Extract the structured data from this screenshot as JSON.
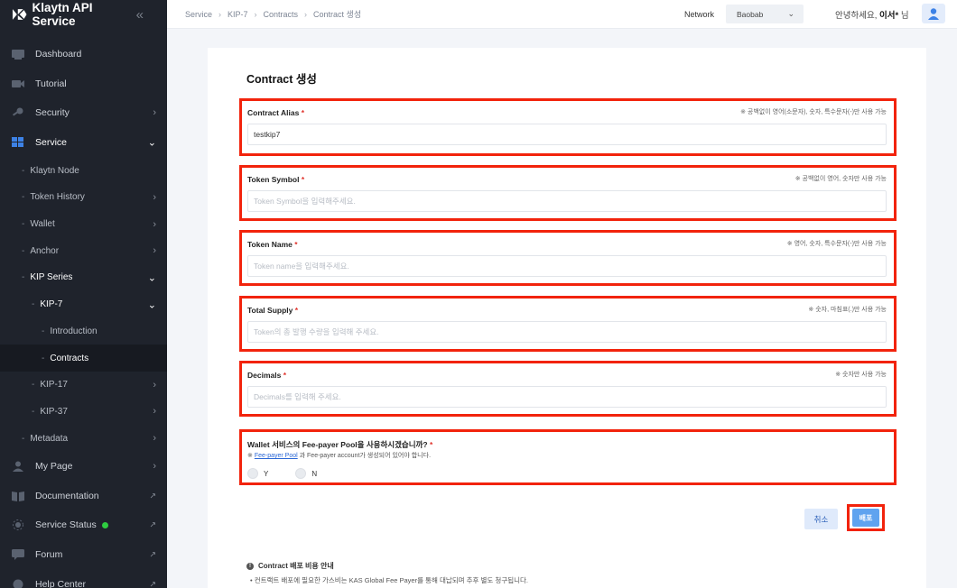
{
  "brand": {
    "name": "Klaytn API Service",
    "collapse_icon": "double-chevron-left"
  },
  "sidebar": {
    "items": [
      {
        "label": "Dashboard",
        "icon": "dashboard-icon"
      },
      {
        "label": "Tutorial",
        "icon": "video-icon"
      },
      {
        "label": "Security",
        "icon": "key-icon"
      },
      {
        "label": "Service",
        "icon": "grid-icon"
      },
      {
        "label": "Klaytn Node"
      },
      {
        "label": "Token History"
      },
      {
        "label": "Wallet"
      },
      {
        "label": "Anchor"
      },
      {
        "label": "KIP Series"
      },
      {
        "label": "KIP-7"
      },
      {
        "label": "Introduction"
      },
      {
        "label": "Contracts"
      },
      {
        "label": "KIP-17"
      },
      {
        "label": "KIP-37"
      },
      {
        "label": "Metadata"
      },
      {
        "label": "My Page",
        "icon": "user-icon"
      },
      {
        "label": "Documentation",
        "icon": "book-icon"
      },
      {
        "label": "Service Status",
        "icon": "status-icon",
        "status_color": "#2ecc40"
      },
      {
        "label": "Forum",
        "icon": "chat-icon"
      },
      {
        "label": "Help Center",
        "icon": "help-icon"
      }
    ]
  },
  "topbar": {
    "breadcrumb": [
      "Service",
      "KIP-7",
      "Contracts",
      "Contract 생성"
    ],
    "network_label": "Network",
    "network_value": "Baobab",
    "greeting_prefix": "안녕하세요,",
    "user_name": "이서*",
    "greeting_suffix": "님"
  },
  "form": {
    "title": "Contract 생성",
    "fields": [
      {
        "label": "Contract Alias",
        "hint": "※ 공백없이 영어(소문자), 숫자, 특수문자(-)만 사용 가능",
        "value": "testkip7",
        "placeholder": ""
      },
      {
        "label": "Token Symbol",
        "hint": "※ 공백없이 영어, 숫자만 사용 가능",
        "value": "",
        "placeholder": "Token Symbol을 입력해주세요."
      },
      {
        "label": "Token Name",
        "hint": "※ 영어, 숫자, 특수문자(-)만 사용 가능",
        "value": "",
        "placeholder": "Token name을 입력해주세요."
      },
      {
        "label": "Total Supply",
        "hint": "※ 숫자, 마침표(.)만 사용 가능",
        "value": "",
        "placeholder": "Token의 총 발행 수량을 입력해 주세요."
      },
      {
        "label": "Decimals",
        "hint": "※ 숫자만 사용 가능",
        "value": "",
        "placeholder": "Decimals를 입력해 주세요."
      }
    ],
    "fee_payer": {
      "question": "Wallet 서비스의 Fee-payer Pool을 사용하시겠습니까?",
      "note_prefix": "※",
      "note_link": "Fee-payer Pool",
      "note_text": "과 Fee-payer account가 생성되어 있어야 합니다.",
      "option_yes": "Y",
      "option_no": "N"
    },
    "cancel_label": "취소",
    "deploy_label": "배포"
  },
  "notice": {
    "title": "Contract 배포 비용 안내",
    "line": "• 컨트랙트 배포에 필요한 가스비는 KAS Global Fee Payer를 통해 대납되며 추후 별도 청구됩니다."
  },
  "colors": {
    "sidebar_bg": "#1f232c",
    "highlight": "#f2230c",
    "primary": "#5fa3ef"
  }
}
